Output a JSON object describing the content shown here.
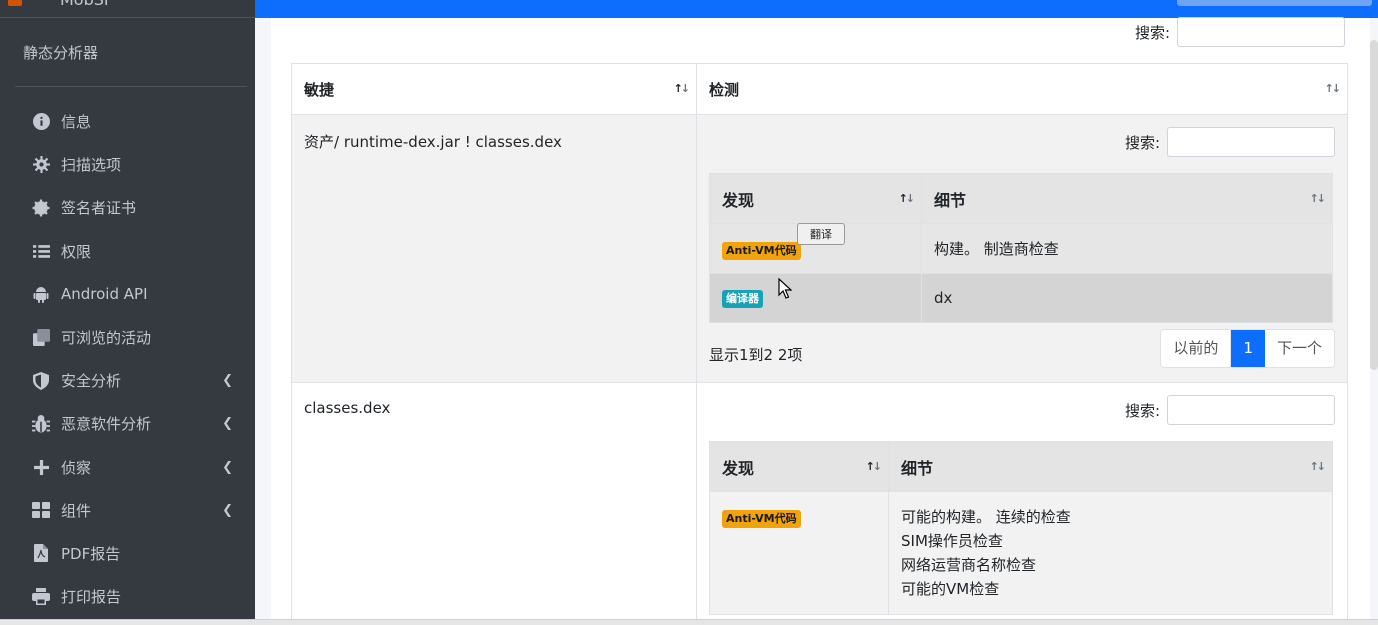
{
  "sidebar": {
    "brand_text": "MobSF",
    "analyzer_title": "静态分析器",
    "items": [
      {
        "label": "信息",
        "icon": "info-circle-icon",
        "has_chevron": false
      },
      {
        "label": "扫描选项",
        "icon": "gear-icon",
        "has_chevron": false
      },
      {
        "label": "签名者证书",
        "icon": "certificate-icon",
        "has_chevron": false
      },
      {
        "label": "权限",
        "icon": "list-icon",
        "has_chevron": false
      },
      {
        "label": "Android API",
        "icon": "android-icon",
        "has_chevron": false
      },
      {
        "label": "可浏览的活动",
        "icon": "copy-icon",
        "has_chevron": false
      },
      {
        "label": "安全分析",
        "icon": "shield-icon",
        "has_chevron": true
      },
      {
        "label": "恶意软件分析",
        "icon": "bug-icon",
        "has_chevron": true
      },
      {
        "label": "侦察",
        "icon": "plus-icon",
        "has_chevron": true
      },
      {
        "label": "组件",
        "icon": "grid-icon",
        "has_chevron": true
      },
      {
        "label": "PDF报告",
        "icon": "file-pdf-icon",
        "has_chevron": false
      },
      {
        "label": "打印报告",
        "icon": "printer-icon",
        "has_chevron": false
      }
    ]
  },
  "top_search_label": "搜索:",
  "outer_table": {
    "col1": "敏捷",
    "col2": "检测",
    "rows": [
      {
        "file": "资产/ runtime-dex.jar ! classes.dex",
        "search_label": "搜索:",
        "inner_headers": [
          "发现",
          "细节"
        ],
        "inner_rows": [
          {
            "badge": "Anti-VM代码",
            "badge_type": "warning",
            "detail": "构建。 制造商检查"
          },
          {
            "badge": "编译器",
            "badge_type": "info",
            "detail": "dx"
          }
        ],
        "info": "显示1到2 2项",
        "pager": {
          "prev": "以前的",
          "page": "1",
          "next": "下一个"
        }
      },
      {
        "file": "classes.dex",
        "search_label": "搜索:",
        "inner_headers": [
          "发现",
          "细节"
        ],
        "inner_rows": [
          {
            "badge": "Anti-VM代码",
            "badge_type": "warning",
            "details": [
              "可能的构建。 连续的检查",
              "SIM操作员检查",
              "网络运营商名称检查",
              "可能的VM检查"
            ]
          }
        ]
      }
    ]
  },
  "translate_popup": "翻译"
}
